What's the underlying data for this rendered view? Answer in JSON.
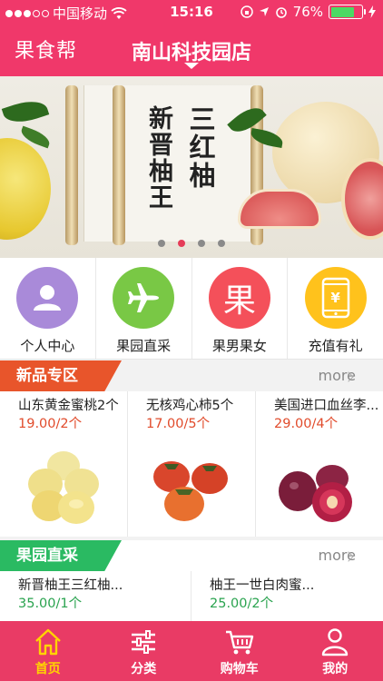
{
  "status_bar": {
    "carrier": "中国移动",
    "time": "15:16",
    "battery_percent": "76%",
    "battery_level": 0.76,
    "signal_bars": 3
  },
  "header": {
    "logo_text": "果食帮",
    "store_name": "南山科技园店"
  },
  "banner": {
    "line1": "三红柚",
    "line2": "新晋柚王",
    "page_count": 4,
    "active_index": 1
  },
  "quick_nav": [
    {
      "label": "个人中心",
      "icon": "user-icon",
      "color": "#a98ad9"
    },
    {
      "label": "果园直采",
      "icon": "airplane-icon",
      "color": "#79c845"
    },
    {
      "label": "果男果女",
      "icon": "guo-character-icon",
      "color": "#f4505a",
      "glyph": "果"
    },
    {
      "label": "充值有礼",
      "icon": "phone-yen-icon",
      "color": "#ffc21c",
      "glyph": "¥"
    }
  ],
  "new_products": {
    "title": "新品专区",
    "color": "#e8552b",
    "more_label": "more",
    "items": [
      {
        "name": "山东黄金蜜桃2个",
        "price": "19.00/2个",
        "image": "peach"
      },
      {
        "name": "无核鸡心柿5个",
        "price": "17.00/5个",
        "image": "persimmon"
      },
      {
        "name": "美国进口血丝李...",
        "price": "29.00/4个",
        "image": "plum"
      }
    ]
  },
  "orchard": {
    "title": "果园直采",
    "color": "#2aba62",
    "more_label": "more",
    "items": [
      {
        "name": "新晋柚王三红柚...",
        "price": "35.00/1个"
      },
      {
        "name": "柚王一世白肉蜜...",
        "price": "25.00/2个"
      }
    ]
  },
  "tab_bar": [
    {
      "label": "首页",
      "icon": "home-icon",
      "active": true
    },
    {
      "label": "分类",
      "icon": "sliders-icon",
      "active": false
    },
    {
      "label": "购物车",
      "icon": "cart-icon",
      "active": false
    },
    {
      "label": "我的",
      "icon": "user-outline-icon",
      "active": false
    }
  ]
}
